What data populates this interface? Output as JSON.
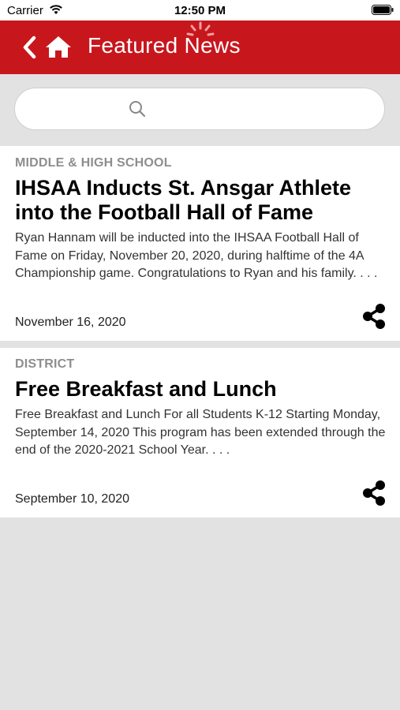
{
  "status_bar": {
    "carrier": "Carrier",
    "time": "12:50 PM",
    "wifi_icon": "wifi-icon",
    "battery_icon": "battery-icon"
  },
  "nav": {
    "title": "Featured News",
    "back_icon": "chevron-left-icon",
    "home_icon": "home-icon",
    "background_color": "#c8161d"
  },
  "search": {
    "placeholder": "",
    "value": "",
    "icon": "search-icon"
  },
  "articles": [
    {
      "category": "MIDDLE & HIGH SCHOOL",
      "title": "IHSAA Inducts St. Ansgar Athlete into the Football Hall of Fame",
      "summary": "Ryan Hannam will be inducted into the IHSAA Football Hall of Fame on Friday, November 20, 2020, during halftime of the 4A Championship game. Congratulations to Ryan and his family. . . .",
      "date": "November 16, 2020",
      "share_icon": "share-icon"
    },
    {
      "category": "DISTRICT",
      "title": "Free Breakfast and Lunch",
      "summary": "Free Breakfast and Lunch For all Students K-12 Starting Monday, September 14, 2020 This program has been extended through the end of the 2020-2021 School Year.   . . .",
      "date": "September 10, 2020",
      "share_icon": "share-icon"
    }
  ]
}
